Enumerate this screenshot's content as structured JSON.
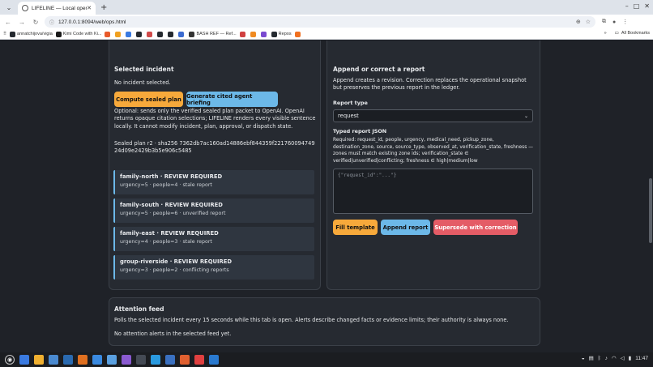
{
  "browser": {
    "tab_title": "LIFELINE — Local operations",
    "url": "127.0.0.1:8094/web/ops.html",
    "new_tab_label": "+",
    "bookmarks": [
      {
        "label": "annatchijova/vigia",
        "color": "#24292f"
      },
      {
        "label": "Kimi Code with Ki...",
        "color": "#1a1a1a"
      },
      {
        "label": "",
        "color": "#e85a2a"
      },
      {
        "label": "",
        "color": "#f0a020"
      },
      {
        "label": "",
        "color": "#3a7ae0"
      },
      {
        "label": "",
        "color": "#24292f"
      },
      {
        "label": "",
        "color": "#d04a4a"
      },
      {
        "label": "",
        "color": "#24292f"
      },
      {
        "label": "",
        "color": "#24292f"
      },
      {
        "label": "",
        "color": "#3a6ad0"
      },
      {
        "label": "BASH REF — Ref...",
        "color": "#333"
      },
      {
        "label": "",
        "color": "#d04040"
      },
      {
        "label": "",
        "color": "#f08a20"
      },
      {
        "label": "",
        "color": "#7a4ad0"
      },
      {
        "label": "Repos",
        "color": "#24292f"
      },
      {
        "label": "",
        "color": "#f07020"
      }
    ],
    "all_bookmarks_label": "All Bookmarks"
  },
  "selected_incident": {
    "title": "Selected incident",
    "status": "No incident selected.",
    "compute_button": "Compute sealed plan",
    "briefing_button": "Generate cited agent briefing",
    "note": "Optional: sends only the verified sealed plan packet to OpenAI. OpenAI returns opaque citation selections; LIFELINE renders every visible sentence locally. It cannot modify incident, plan, approval, or dispatch state.",
    "sealed_plan": "Sealed plan r2 · sha256 7362db7ac160ad14886ebf844359f22176009474924d09e2429b3b5e906c5485",
    "families": [
      {
        "title": "family-north · REVIEW REQUIRED",
        "detail": "urgency=5 · people=4 · stale report"
      },
      {
        "title": "family-south · REVIEW REQUIRED",
        "detail": "urgency=5 · people=6 · unverified report"
      },
      {
        "title": "family-east · REVIEW REQUIRED",
        "detail": "urgency=4 · people=3 · stale report"
      },
      {
        "title": "group-riverside · REVIEW REQUIRED",
        "detail": "urgency=3 · people=2 · conflicting reports"
      }
    ]
  },
  "report": {
    "title": "Append or correct a report",
    "description": "Append creates a revision. Correction replaces the operational snapshot but preserves the previous report in the ledger.",
    "type_label": "Report type",
    "type_value": "request",
    "json_label": "Typed report JSON",
    "required_text": "Required: request_id, people, urgency, medical_need, pickup_zone, destination_zone, source, source_type, observed_at, verification_state, freshness — zones must match existing zone ids; verification_state ∈ verified|unverified|conflicting; freshness ∈ high|medium|low",
    "json_placeholder": "{\"request_id\":\"...\"}",
    "fill_button": "Fill template",
    "append_button": "Append report",
    "supersede_button": "Supersede with correction"
  },
  "attention": {
    "title": "Attention feed",
    "description": "Polls the selected incident every 15 seconds while this tab is open. Alerts describe changed facts or evidence limits; their authority is always none.",
    "status": "No attention alerts in the selected feed yet."
  },
  "taskbar": {
    "time": "11:47",
    "apps": [
      "#3a7ae0",
      "#f0b030",
      "#4a8ad0",
      "#2a6ab0",
      "#e07020",
      "#3a8ae0",
      "#5aa0e0",
      "#8a5ad0",
      "#444a54",
      "#2a9ae0",
      "#3a70c0",
      "#e06030",
      "#e04040",
      "#2a7ad0"
    ]
  }
}
